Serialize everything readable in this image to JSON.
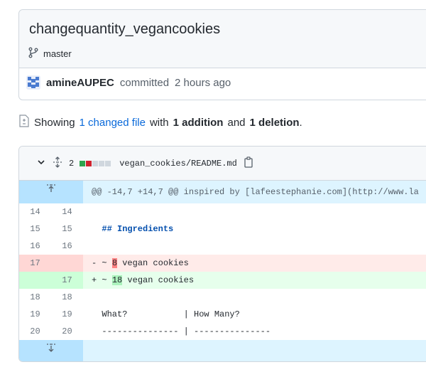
{
  "commit": {
    "title": "changequantity_vegancookies",
    "branch": "master",
    "author": "amineAUPEC",
    "action": "committed",
    "time": "2 hours ago"
  },
  "summary": {
    "prefix": "Showing",
    "changed": "1 changed file",
    "with": "with",
    "additions": "1 addition",
    "and": "and",
    "deletions": "1 deletion",
    "end": "."
  },
  "file": {
    "change_count": "2",
    "path": "vegan_cookies/README.md"
  },
  "hunk": {
    "header": "@@ -14,7 +14,7 @@ inspired by [lafeestephanie.com](http://www.la"
  },
  "lines": [
    {
      "type": "ctx",
      "old": "14",
      "new": "14",
      "text": ""
    },
    {
      "type": "ctx",
      "old": "15",
      "new": "15",
      "text": "  ## Ingredients"
    },
    {
      "type": "ctx",
      "old": "16",
      "new": "16",
      "text": ""
    },
    {
      "type": "del",
      "old": "17",
      "new": "",
      "pre": "- ~ ",
      "hl": "8",
      "post": " vegan cookies"
    },
    {
      "type": "add",
      "old": "",
      "new": "17",
      "pre": "+ ~ ",
      "hl": "18",
      "post": " vegan cookies"
    },
    {
      "type": "ctx",
      "old": "18",
      "new": "18",
      "text": ""
    },
    {
      "type": "ctx",
      "old": "19",
      "new": "19",
      "text": "  What?           | How Many?"
    },
    {
      "type": "ctx",
      "old": "20",
      "new": "20",
      "text": "  --------------- | ---------------"
    }
  ],
  "colors": {
    "link": "#0969da",
    "addition": "#2da44e",
    "deletion": "#cf222e",
    "neutral": "#d0d7de"
  },
  "icons": {
    "branch": "git-branch-icon",
    "diff_file": "file-diff-icon",
    "chevron": "chevron-down-icon",
    "unfold": "unfold-icon",
    "copy": "copy-icon",
    "expand_up": "expand-up-icon",
    "expand_down": "expand-down-icon"
  }
}
